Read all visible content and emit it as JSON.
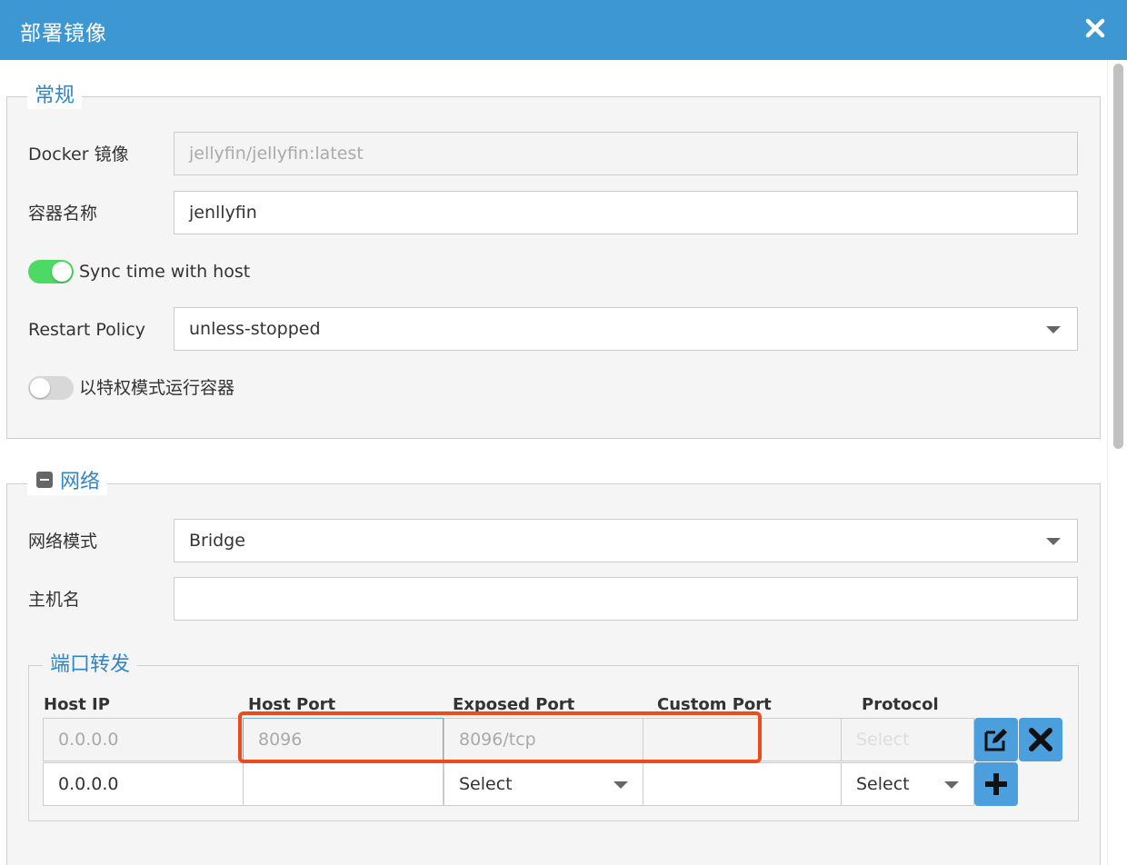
{
  "dialog": {
    "title": "部署镜像",
    "close_icon": "close-icon"
  },
  "general": {
    "legend": "常规",
    "image_label": "Docker 镜像",
    "image_value": "jellyfin/jellyfin:latest",
    "name_label": "容器名称",
    "name_value": "jenllyfin",
    "sync_time_label": "Sync time with host",
    "sync_time_on": true,
    "restart_label": "Restart Policy",
    "restart_value": "unless-stopped",
    "privileged_label": "以特权模式运行容器",
    "privileged_on": false
  },
  "network": {
    "legend": "网络",
    "mode_label": "网络模式",
    "mode_value": "Bridge",
    "hostname_label": "主机名",
    "hostname_value": ""
  },
  "ports": {
    "legend": "端口转发",
    "columns": [
      "Host IP",
      "Host Port",
      "Exposed Port",
      "Custom Port",
      "Protocol"
    ],
    "rows": [
      {
        "host_ip": "0.0.0.0",
        "host_port": "8096",
        "exposed_port": "8096/tcp",
        "custom_port": "",
        "protocol": "Select"
      },
      {
        "host_ip": "0.0.0.0",
        "host_port": "",
        "exposed_port": "Select",
        "custom_port": "",
        "protocol": "Select"
      }
    ]
  },
  "colors": {
    "header": "#3d97d3",
    "accent": "#2f86c5",
    "toggle_on": "#4cd964",
    "action_button": "#4a9fdc",
    "highlight": "#ee4a1c"
  }
}
